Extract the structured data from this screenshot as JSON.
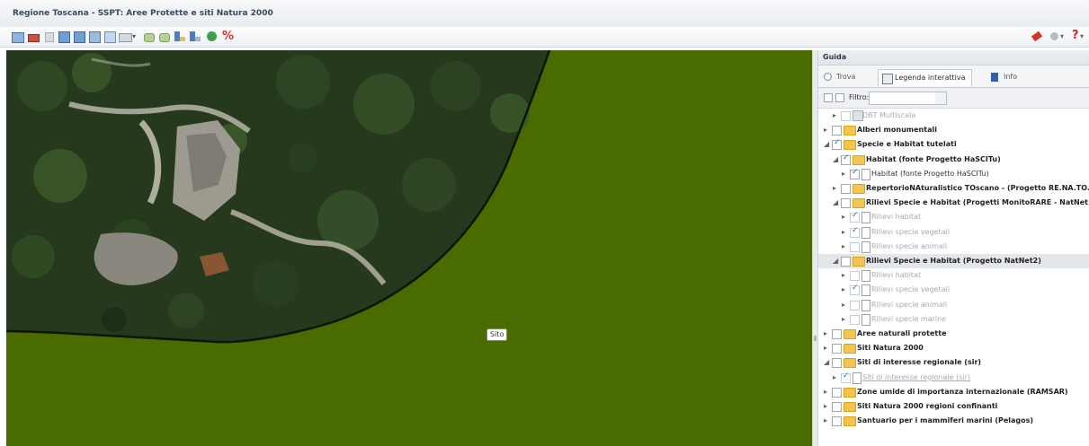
{
  "window": {
    "title": "Regione Toscana - SSPT: Aree Protette e siti Natura 2000"
  },
  "map": {
    "feature_label": "Sito"
  },
  "panel": {
    "title": "Guida",
    "tabs": [
      {
        "label": "Trova",
        "icon": "search-icon"
      },
      {
        "label": "Legenda interattiva",
        "icon": "legend-icon"
      },
      {
        "label": "Info",
        "icon": "info-icon"
      }
    ],
    "filter_label": "Filtro:",
    "filter_value": ""
  },
  "tree": [
    {
      "label": "DBT Multiscala",
      "level": 1,
      "type": "layer",
      "checked": false,
      "expander": "▸",
      "dim": true
    },
    {
      "label": "Alberi monumentali",
      "level": 0,
      "type": "folder",
      "checked": false,
      "expander": "▸",
      "bold": true
    },
    {
      "label": "Specie e Habitat tutelati",
      "level": 0,
      "type": "folder",
      "checked": true,
      "expander": "◢",
      "bold": true
    },
    {
      "label": "Habitat (fonte Progetto HaSCITu)",
      "level": 1,
      "type": "folder",
      "checked": true,
      "expander": "◢",
      "bold": true
    },
    {
      "label": "Habitat (fonte Progetto HaSCITu)",
      "level": 2,
      "type": "doc",
      "checked": true,
      "expander": "▸"
    },
    {
      "label": "RepertorioNAturalistico TOscano - (Progetto RE.NA.TO.)",
      "level": 1,
      "type": "folder",
      "checked": false,
      "expander": "▸",
      "bold": true
    },
    {
      "label": "Rilievi Specie e Habitat (Progetti MonitoRARE - NatNet)",
      "level": 1,
      "type": "folder",
      "checked": false,
      "expander": "◢",
      "bold": true
    },
    {
      "label": "Rilievi habitat",
      "level": 2,
      "type": "doc",
      "checked": true,
      "expander": "▸",
      "dim": true
    },
    {
      "label": "Rilievi specie vegetali",
      "level": 2,
      "type": "doc",
      "checked": true,
      "expander": "▸",
      "dim": true
    },
    {
      "label": "Rilievi specie animali",
      "level": 2,
      "type": "doc",
      "checked": false,
      "expander": "▸",
      "dim": true
    },
    {
      "label": "Rilievi Specie e Habitat (Progetto NatNet2)",
      "level": 1,
      "type": "folder",
      "checked": false,
      "expander": "◢",
      "bold": true,
      "selected": true
    },
    {
      "label": "Rilievi habitat",
      "level": 2,
      "type": "doc",
      "checked": false,
      "expander": "▸",
      "dim": true
    },
    {
      "label": "Rilievi specie vegetali",
      "level": 2,
      "type": "doc",
      "checked": true,
      "expander": "▸",
      "dim": true
    },
    {
      "label": "Rilievi specie animali",
      "level": 2,
      "type": "doc",
      "checked": false,
      "expander": "▸",
      "dim": true
    },
    {
      "label": "Rilievi specie marine",
      "level": 2,
      "type": "doc",
      "checked": false,
      "expander": "▸",
      "dim": true
    },
    {
      "label": "Aree naturali protette",
      "level": 0,
      "type": "folder",
      "checked": false,
      "expander": "▸",
      "bold": true
    },
    {
      "label": "Siti Natura 2000",
      "level": 0,
      "type": "folder",
      "checked": false,
      "expander": "▸",
      "bold": true
    },
    {
      "label": "Siti di interesse regionale (sir)",
      "level": 0,
      "type": "folder",
      "checked": false,
      "expander": "◢",
      "bold": true
    },
    {
      "label": "Siti di interesse regionale (sir)",
      "level": 1,
      "type": "doc",
      "checked": true,
      "expander": "▸",
      "dim": true,
      "underline": true
    },
    {
      "label": "Zone umide di importanza internazionale (RAMSAR)",
      "level": 0,
      "type": "folder",
      "checked": false,
      "expander": "▸",
      "bold": true
    },
    {
      "label": "Siti Natura 2000 regioni confinanti",
      "level": 0,
      "type": "folder",
      "checked": false,
      "expander": "▸",
      "bold": true
    },
    {
      "label": "Santuario per i mammiferi marini (Pelagos)",
      "level": 0,
      "type": "folder",
      "checked": false,
      "expander": "▸",
      "bold": true
    }
  ],
  "colors": {
    "map_fill": "#4a6b00",
    "folder": "#f2c64d",
    "accent": "#2b6fbf"
  }
}
